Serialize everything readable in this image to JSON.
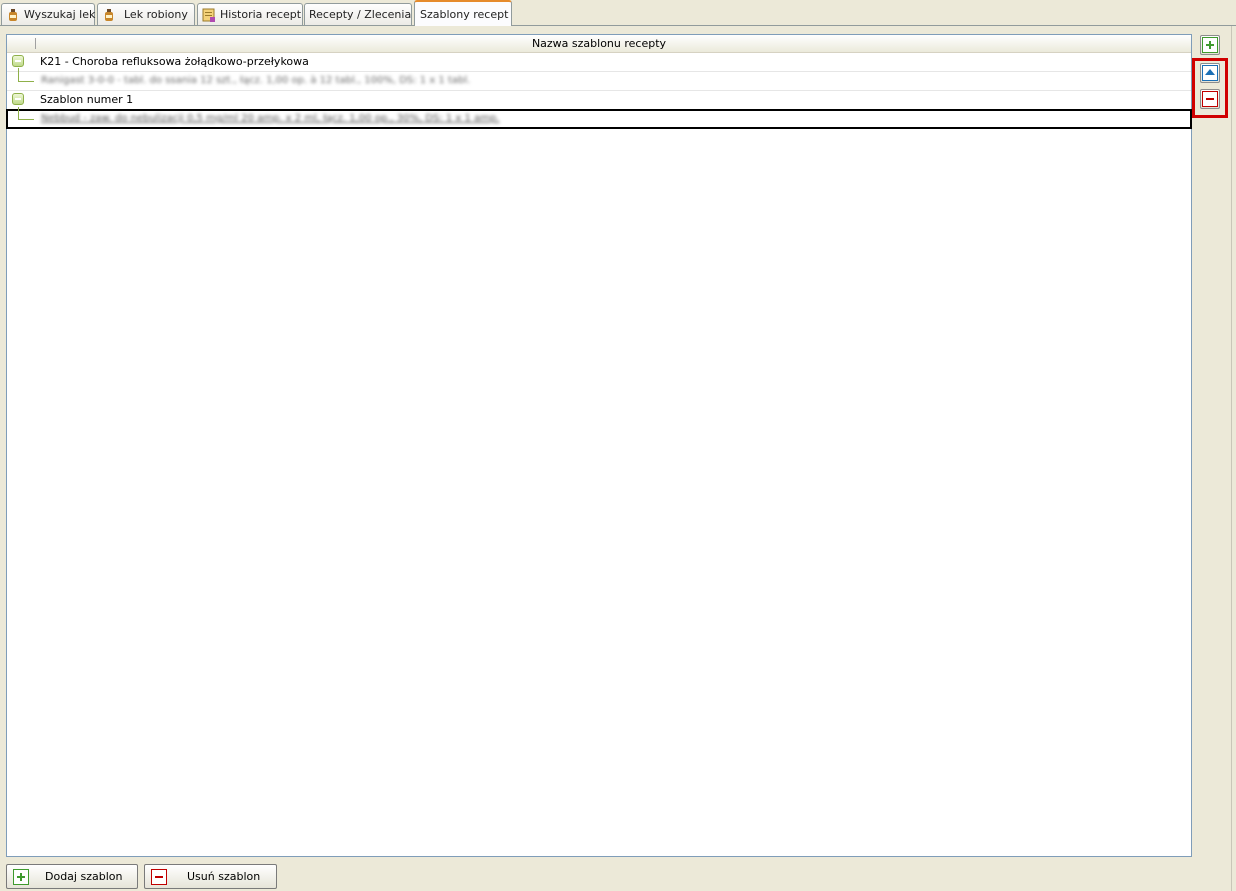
{
  "tabs": [
    {
      "label": "Wyszukaj lek",
      "icon": "bottle-icon"
    },
    {
      "label": "Lek robiony",
      "icon": "bottle-icon"
    },
    {
      "label": "Historia recept",
      "icon": "prescription-icon"
    },
    {
      "label": "Recepty / Zlecenia",
      "icon": ""
    },
    {
      "label": "Szablony recept",
      "icon": "",
      "active": true
    }
  ],
  "tree": {
    "column_header": "Nazwa szablonu recepty",
    "rows": [
      {
        "type": "group",
        "label": "K21 - Choroba refluksowa żołądkowo-przełykowa"
      },
      {
        "type": "child",
        "label": "Ranigast 3-0-0 - tabl. do ssania 12 szt., łącz. 1,00 op. à 12 tabl., 100%, DS: 1 x 1 tabl."
      },
      {
        "type": "group",
        "label": "Szablon numer 1"
      },
      {
        "type": "child",
        "label": "Nebbud - zaw. do nebulizacji 0,5 mg/ml 20 amp. x 2 ml, łącz. 1,00 op., 30%, DS: 1 x 1 amp.",
        "selected": true
      }
    ]
  },
  "side_buttons": [
    {
      "name": "add-icon"
    },
    {
      "name": "move-up-icon"
    },
    {
      "name": "remove-icon"
    }
  ],
  "bottom_buttons": {
    "add_label": "Dodaj szablon",
    "remove_label": "Usuń szablon"
  },
  "colors": {
    "highlight": "#d00000",
    "active_tab_accent": "#e68b2c",
    "tree_line": "#8fb04a"
  }
}
